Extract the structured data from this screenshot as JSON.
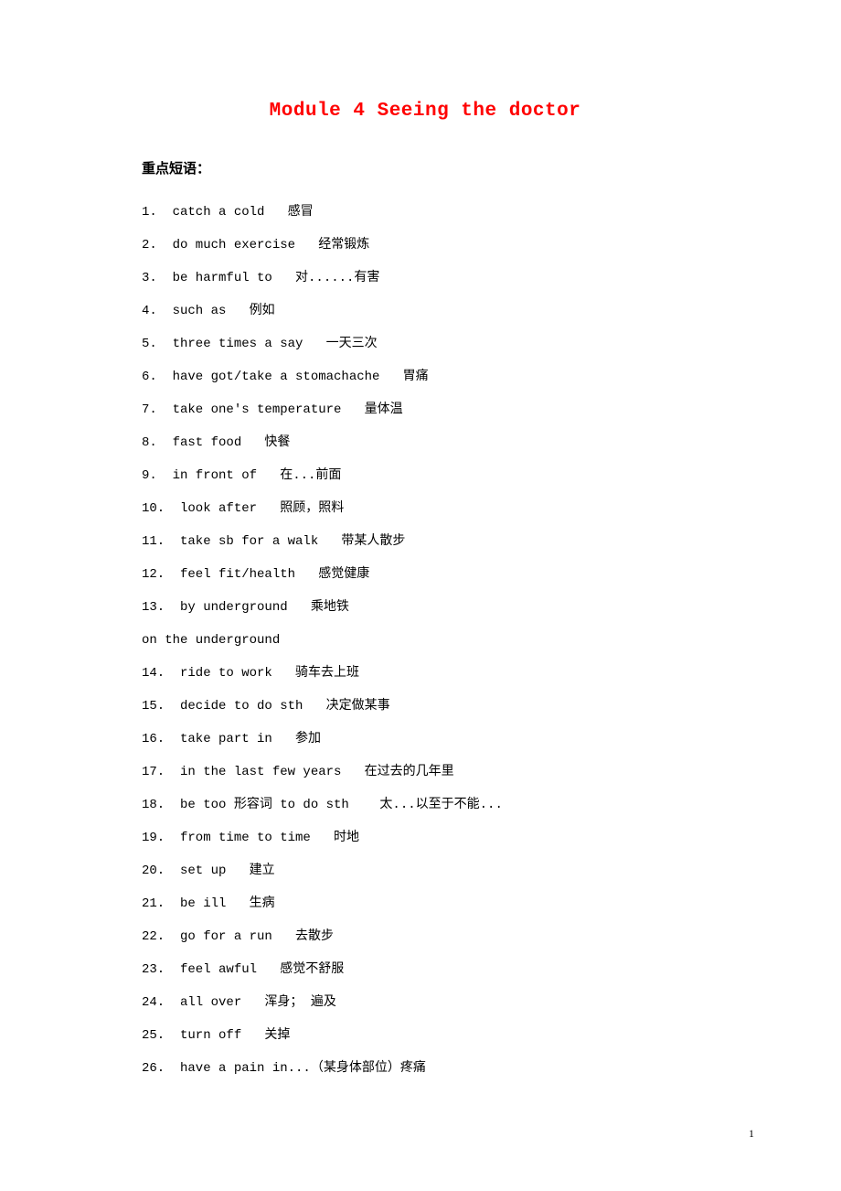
{
  "module_title": "Module 4  Seeing the doctor",
  "section_title": "重点短语：",
  "items": [
    {
      "num": "1. ",
      "en": "catch a cold",
      "zh": "感冒"
    },
    {
      "num": "2. ",
      "en": "do much exercise",
      "zh": "经常锻炼"
    },
    {
      "num": "3. ",
      "en": "be harmful to",
      "zh": "对......有害"
    },
    {
      "num": "4. ",
      "en": "such as",
      "zh": "例如"
    },
    {
      "num": "5. ",
      "en": "three times a say",
      "zh": "一天三次"
    },
    {
      "num": "6. ",
      "en": "have got/take a stomachache",
      "zh": "胃痛"
    },
    {
      "num": "7. ",
      "en": "take one's temperature",
      "zh": "量体温"
    },
    {
      "num": "8. ",
      "en": "fast food",
      "zh": "快餐"
    },
    {
      "num": "9. ",
      "en": "in front of",
      "zh": "在...前面"
    },
    {
      "num": "10. ",
      "en": "look after",
      "zh": "照顾，照料"
    },
    {
      "num": "11. ",
      "en": "take sb for a walk",
      "zh": "带某人散步"
    },
    {
      "num": "12. ",
      "en": "feel fit/health",
      "zh": "感觉健康"
    },
    {
      "num": "13. ",
      "en": "by underground",
      "zh": "乘地铁"
    },
    {
      "num": "sub",
      "en": "on the underground",
      "zh": ""
    },
    {
      "num": "14. ",
      "en": "ride to work",
      "zh": "骑车去上班"
    },
    {
      "num": "15. ",
      "en": "decide to do sth",
      "zh": "决定做某事"
    },
    {
      "num": "16. ",
      "en": "take part in",
      "zh": "参加"
    },
    {
      "num": "17. ",
      "en": "in the last few years",
      "zh": "在过去的几年里"
    },
    {
      "num": "18. ",
      "en": "be too 形容词 to do sth ",
      "zh": "太...以至于不能..."
    },
    {
      "num": "19. ",
      "en": "from time to time",
      "zh": "时地"
    },
    {
      "num": "20. ",
      "en": "set up",
      "zh": "建立"
    },
    {
      "num": "21. ",
      "en": "be ill",
      "zh": "生病"
    },
    {
      "num": "22. ",
      "en": "go for a run",
      "zh": "去散步"
    },
    {
      "num": "23. ",
      "en": "feel awful",
      "zh": "感觉不舒服"
    },
    {
      "num": "24. ",
      "en": "all over",
      "zh": "浑身； 遍及"
    },
    {
      "num": "25. ",
      "en": "turn off",
      "zh": "关掉"
    },
    {
      "num": "26. ",
      "en": "have a pain in...（某身体部位）疼痛",
      "zh": ""
    }
  ],
  "page_number": "1"
}
